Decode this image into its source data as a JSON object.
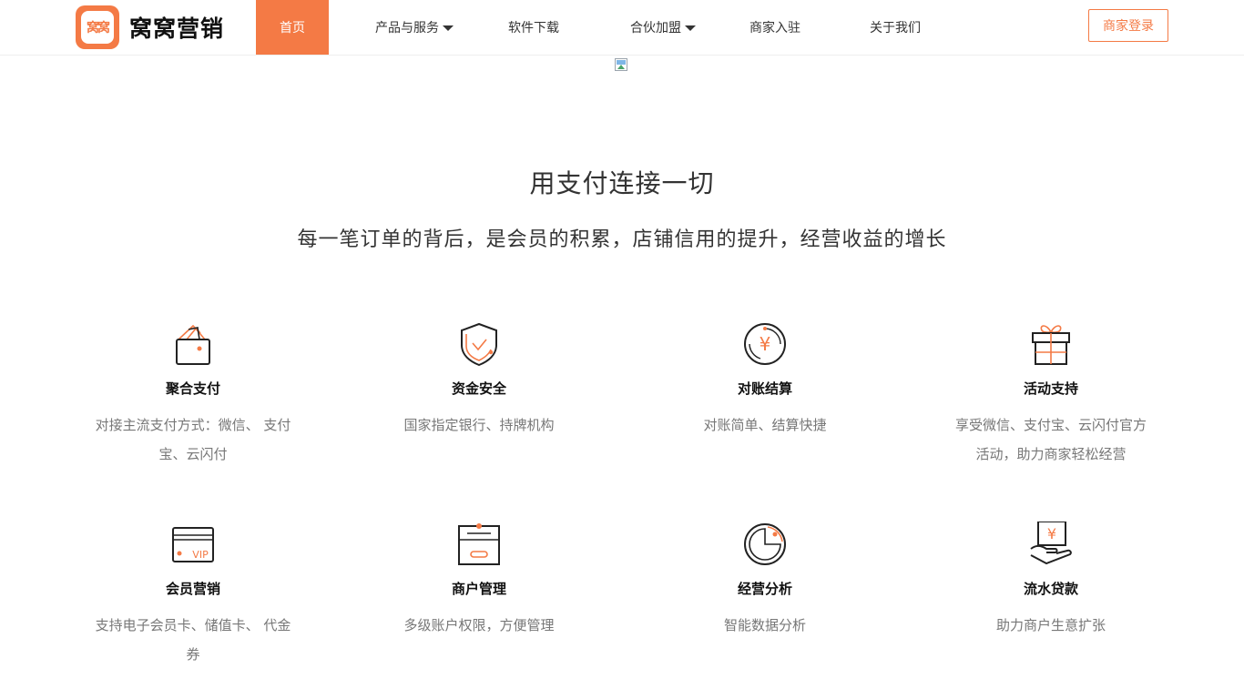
{
  "header": {
    "logo_badge_text": "窝窝",
    "logo_text": "窝窝营销",
    "nav": [
      {
        "label": "首页",
        "active": true,
        "has_dropdown": false
      },
      {
        "label": "产品与服务",
        "active": false,
        "has_dropdown": true
      },
      {
        "label": "软件下载",
        "active": false,
        "has_dropdown": false
      },
      {
        "label": "合伙加盟",
        "active": false,
        "has_dropdown": true
      },
      {
        "label": "商家入驻",
        "active": false,
        "has_dropdown": false
      },
      {
        "label": "关于我们",
        "active": false,
        "has_dropdown": false
      }
    ],
    "login_label": "商家登录"
  },
  "hero": {
    "headline": "用支付连接一切",
    "subline": "每一笔订单的背后，是会员的积累，店铺信用的提升，经营收益的增长"
  },
  "features": [
    {
      "icon": "wallet-icon",
      "title": "聚合支付",
      "desc": "对接主流支付方式：微信、 支付宝、云闪付"
    },
    {
      "icon": "shield-check-icon",
      "title": "资金安全",
      "desc": "国家指定银行、持牌机构"
    },
    {
      "icon": "yuan-clock-icon",
      "title": "对账结算",
      "desc": "对账简单、结算快捷"
    },
    {
      "icon": "gift-icon",
      "title": "活动支持",
      "desc": "享受微信、支付宝、云闪付官方活动，助力商家轻松经营"
    },
    {
      "icon": "vip-card-icon",
      "title": "会员营销",
      "desc": "支持电子会员卡、储值卡、 代金券"
    },
    {
      "icon": "merchant-box-icon",
      "title": "商户管理",
      "desc": "多级账户权限，方便管理"
    },
    {
      "icon": "pie-chart-icon",
      "title": "经营分析",
      "desc": "智能数据分析"
    },
    {
      "icon": "hand-money-icon",
      "title": "流水贷款",
      "desc": "助力商户生意扩张"
    }
  ],
  "colors": {
    "accent": "#f47a45",
    "text": "#333333",
    "muted": "#777777"
  }
}
